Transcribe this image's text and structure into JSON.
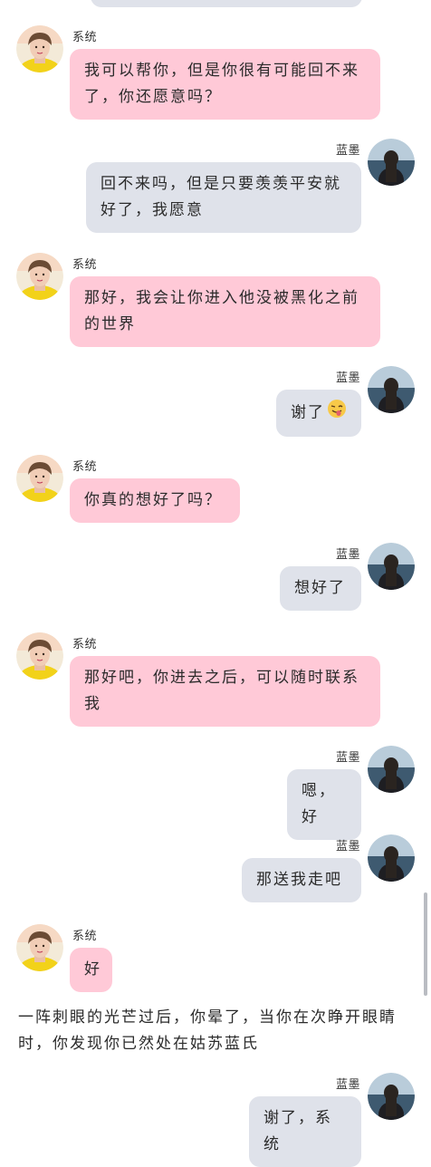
{
  "senders": {
    "system": "系统",
    "lanmo": "蓝墨"
  },
  "messages": [
    {
      "sender": "系统",
      "text": "我可以帮你，但是你很有可能回不来了，你还愿意吗？"
    },
    {
      "sender": "蓝墨",
      "text": "回不来吗，但是只要羡羡平安就好了，我愿意"
    },
    {
      "sender": "系统",
      "text": "那好，我会让你进入他没被黑化之前的世界"
    },
    {
      "sender": "蓝墨",
      "text": "谢了",
      "emoji": "tongue-wink-emoji"
    },
    {
      "sender": "系统",
      "text": "你真的想好了吗？"
    },
    {
      "sender": "蓝墨",
      "text": "想好了"
    },
    {
      "sender": "系统",
      "text": "那好吧，你进去之后，可以随时联系我"
    },
    {
      "sender": "蓝墨",
      "text": "嗯，好"
    },
    {
      "sender": "蓝墨",
      "text": "那送我走吧"
    },
    {
      "sender": "系统",
      "text": "好"
    },
    {
      "sender": "蓝墨",
      "text": "谢了，系统"
    }
  ],
  "narration": "一阵刺眼的光芒过后，你晕了，当你在次睁开眼睛时，你发现你已然处在姑苏蓝氏",
  "colors": {
    "system_bubble": "#ffc9d7",
    "user_bubble": "#dfe2ea"
  },
  "icons": {
    "system_avatar": "yellow-shirt-portrait-avatar",
    "user_avatar": "seaside-girl-avatar"
  }
}
